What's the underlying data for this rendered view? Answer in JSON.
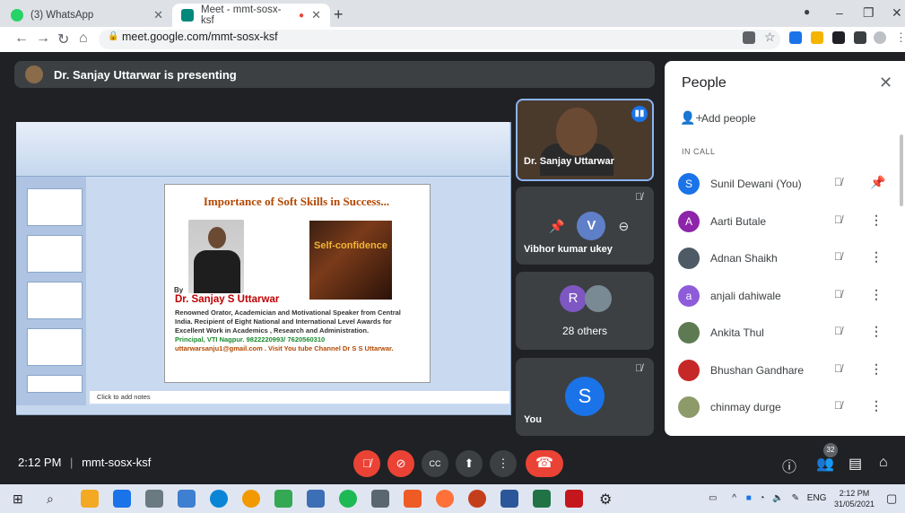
{
  "browser": {
    "tabs": [
      {
        "title": "(3) WhatsApp",
        "icon": "whatsapp-icon",
        "color": "#25d366"
      },
      {
        "title": "Meet - mmt-sosx-ksf",
        "icon": "meet-icon",
        "color": "#00897b"
      }
    ],
    "url": "meet.google.com/mmt-sosx-ksf"
  },
  "presenting_banner": "Dr. Sanjay Uttarwar is presenting",
  "slide": {
    "title": "Importance of Soft Skills in Success...",
    "image_text": "Self-confidence",
    "by": "By",
    "name": "Dr. Sanjay  S Uttarwar",
    "desc1": "Renowned Orator, Academician and Motivational Speaker from Central",
    "desc2": "India.  Recipient of Eight National and International Level Awards for",
    "desc3": "Excellent Work in Academics , Research and Administration.",
    "contact": "Principal, VTI Nagpur.  9822220993/ 7620560310",
    "email": "uttarwarsanju1@gmail.com .  Visit You tube Channel  Dr S S Uttarwar.",
    "notes_placeholder": "Click to add notes"
  },
  "tiles": [
    {
      "name": "Dr. Sanjay Uttarwar"
    },
    {
      "name": "Vibhor kumar ukey",
      "initial": "V"
    },
    {
      "initial": "R",
      "label": "28 others"
    },
    {
      "name": "You",
      "initial": "S"
    }
  ],
  "people": {
    "title": "People",
    "add_label": "Add people",
    "section": "IN CALL",
    "list": [
      {
        "name": "Sunil Dewani (You)",
        "initial": "S",
        "color": "#1a73e8"
      },
      {
        "name": "Aarti Butale",
        "initial": "A",
        "color": "#8e24aa"
      },
      {
        "name": "Adnan Shaikh",
        "initial": "",
        "color": "#4e5b66"
      },
      {
        "name": "anjali dahiwale",
        "initial": "a",
        "color": "#8e5cd9"
      },
      {
        "name": "Ankita Thul",
        "initial": "",
        "color": "#5d7a52"
      },
      {
        "name": "Bhushan Gandhare",
        "initial": "",
        "color": "#c62828"
      },
      {
        "name": "chinmay durge",
        "initial": "",
        "color": "#8d9a6a"
      }
    ]
  },
  "meeting": {
    "time": "2:12 PM",
    "code": "mmt-sosx-ksf",
    "participant_count": "32"
  },
  "taskbar": {
    "time": "2:12 PM",
    "date": "31/05/2021",
    "lang": "ENG"
  }
}
